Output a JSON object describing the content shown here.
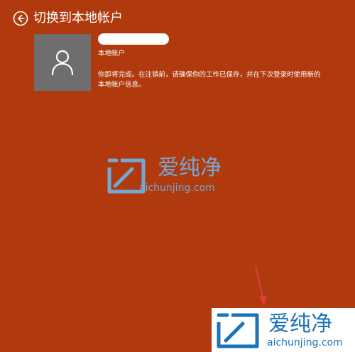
{
  "header": {
    "title": "切换到本地帐户"
  },
  "account": {
    "type_label": "本地帐户",
    "message": "你即将完成。在注销前，请确保你的工作已保存，并在下次登录时使用新的本地帐户信息。"
  },
  "watermark": {
    "brand": "爱纯净",
    "url": "aichunjing.com"
  },
  "colors": {
    "background": "#b03a0e",
    "avatar_box": "#6e6e6e",
    "watermark_light": "#74a8d3",
    "watermark_dark": "#1c73b7",
    "arrow": "#e03c3c"
  },
  "icons": {
    "back": "back-arrow-icon",
    "avatar": "user-avatar-icon",
    "watermark_logo": "watermark-logo-icon",
    "annotation_arrow": "annotation-arrow-icon"
  }
}
